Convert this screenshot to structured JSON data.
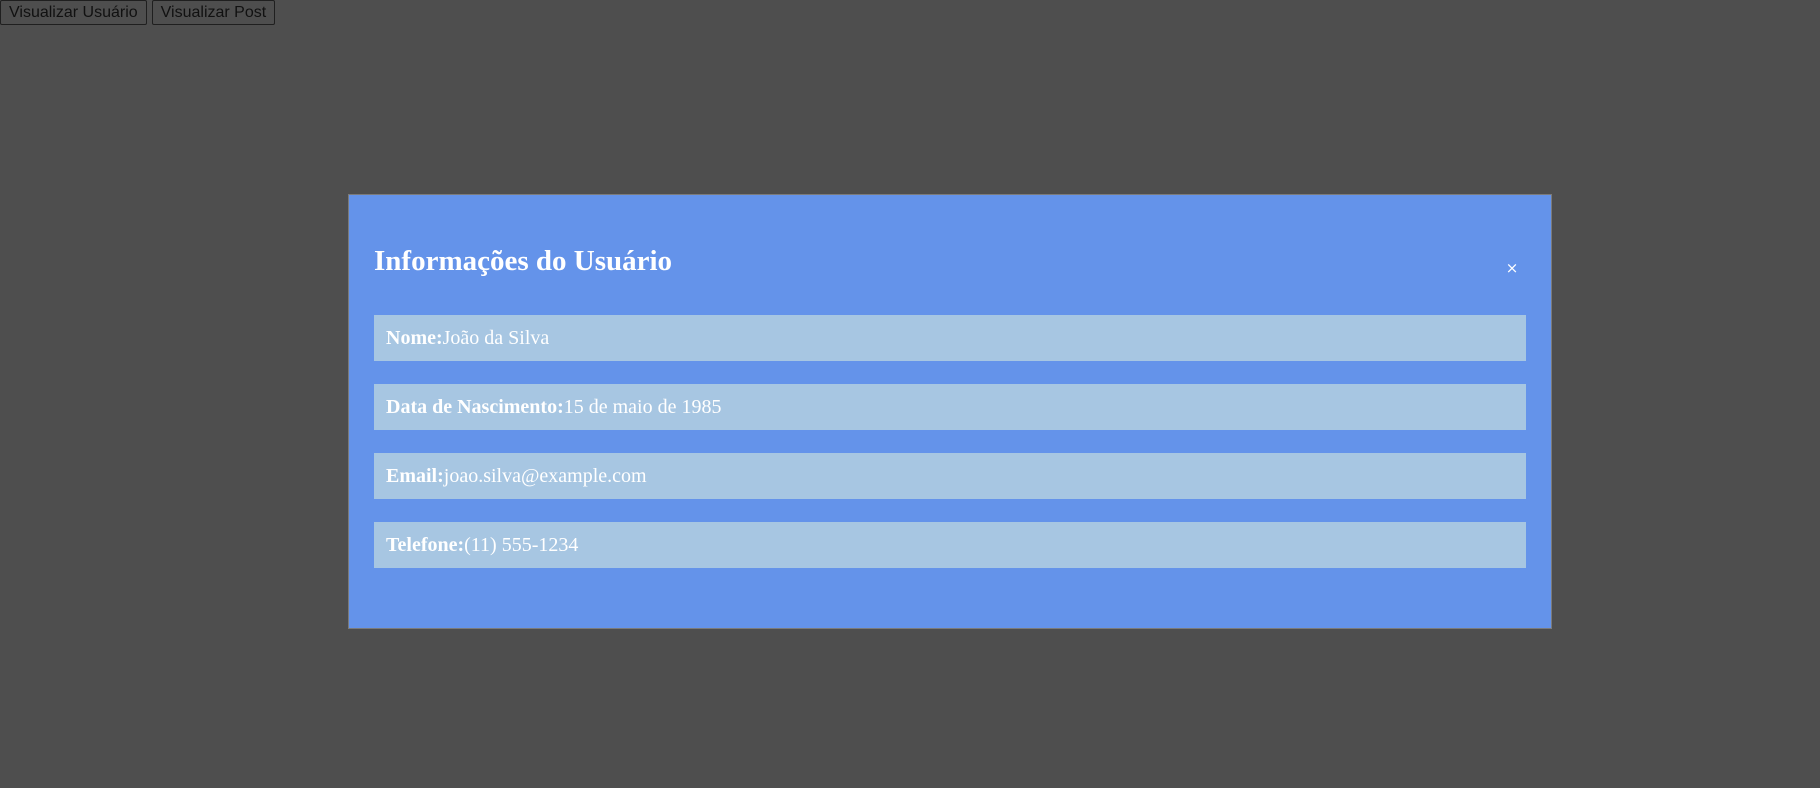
{
  "toolbar": {
    "view_user_label": "Visualizar Usuário",
    "view_post_label": "Visualizar Post"
  },
  "modal": {
    "title": "Informações do Usuário",
    "close_symbol": "×",
    "close_icon": "close-icon",
    "fields": [
      {
        "label": "Nome:",
        "value": "João da Silva"
      },
      {
        "label": "Data de Nascimento:",
        "value": "15 de maio de 1985"
      },
      {
        "label": "Email:",
        "value": "joao.silva@example.com"
      },
      {
        "label": "Telefone:",
        "value": "(11) 555-1234"
      }
    ]
  },
  "colors": {
    "overlay": "#4e4e4e",
    "modal_background": "#6493ea",
    "field_background": "#a7c6e2",
    "text": "#ffffff"
  }
}
